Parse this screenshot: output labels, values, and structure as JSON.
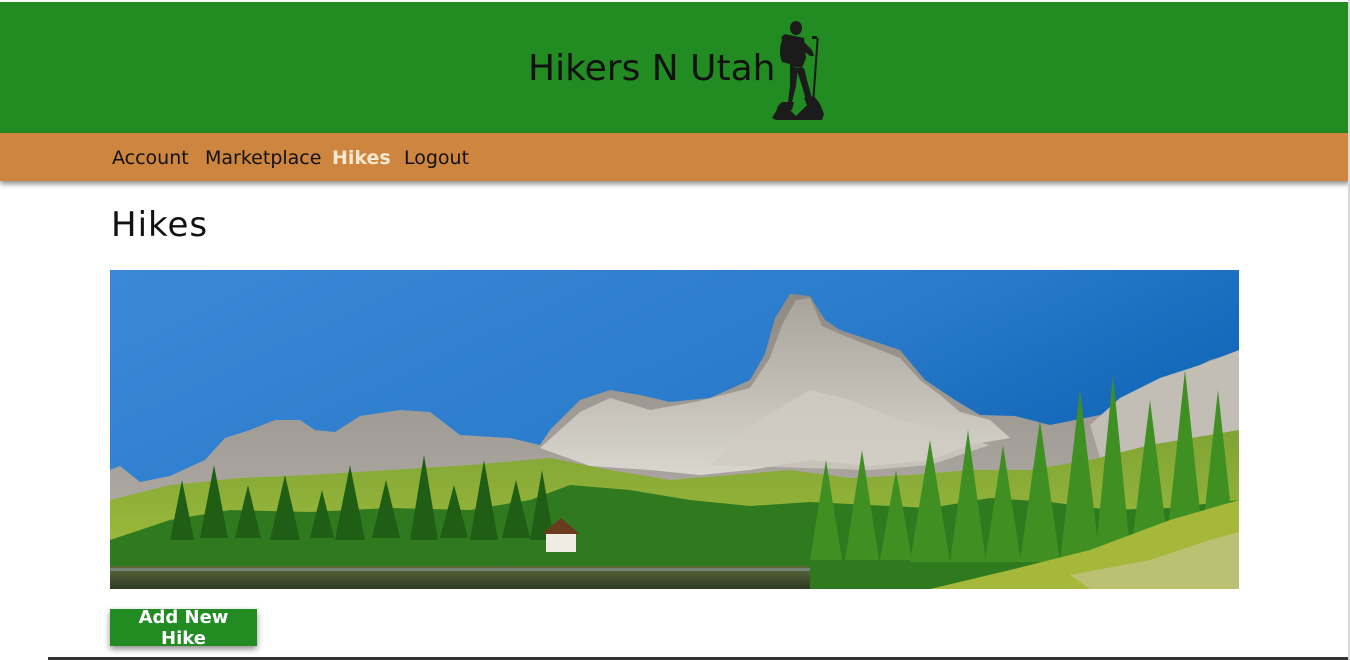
{
  "header": {
    "site_title": "Hikers N Utah",
    "logo_icon": "hiker-silhouette-icon",
    "background_color": "#228b22"
  },
  "nav": {
    "background_color": "#cd853f",
    "items": [
      {
        "label": "Account",
        "active": false
      },
      {
        "label": "Marketplace",
        "active": false
      },
      {
        "label": "Hikes",
        "active": true
      },
      {
        "label": "Logout",
        "active": false
      }
    ]
  },
  "main": {
    "page_title": "Hikes",
    "hero_image": "mountain-lake-landscape",
    "add_button_label": "Add New Hike",
    "button_color": "#228b22"
  }
}
